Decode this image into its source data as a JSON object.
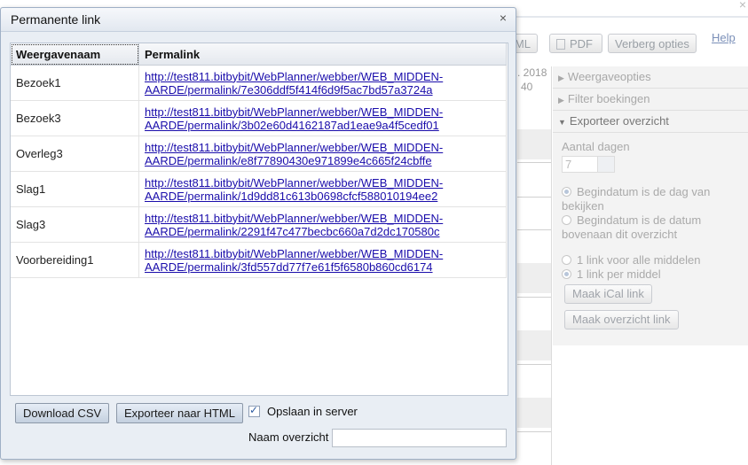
{
  "background": {
    "toolbar": {
      "html_label": "ML",
      "pdf_label": "PDF",
      "hide_label": "Verberg opties",
      "help_label": "Help"
    },
    "date_line1": ". 2018",
    "date_line2": "40",
    "sidebar": {
      "section_view": "Weergaveopties",
      "section_filter": "Filter boekingen",
      "section_export": "Exporteer overzicht",
      "days_label": "Aantal dagen",
      "days_value": "7",
      "radio_start_view": "Begindatum is de dag van bekijken",
      "radio_start_top": "Begindatum is de datum bovenaan dit overzicht",
      "radio_one_link": "1 link voor alle middelen",
      "radio_per_link": "1 link per middel",
      "ical_button": "Maak iCal link",
      "overview_button": "Maak overzicht link"
    }
  },
  "dialog": {
    "title": "Permanente link",
    "close": "×",
    "columns": {
      "name": "Weergavenaam",
      "link": "Permalink"
    },
    "rows": [
      {
        "name": "Bezoek1",
        "link_line1": "http://test811.bitbybit/WebPlanner/webber/WEB_MIDDEN-",
        "link_line2": "AARDE/permalink/7e306ddf5f414f6d9f5ac7bd57a3724a"
      },
      {
        "name": "Bezoek3",
        "link_line1": "http://test811.bitbybit/WebPlanner/webber/WEB_MIDDEN-",
        "link_line2": "AARDE/permalink/3b02e60d4162187ad1eae9a4f5cedf01"
      },
      {
        "name": "Overleg3",
        "link_line1": "http://test811.bitbybit/WebPlanner/webber/WEB_MIDDEN-",
        "link_line2": "AARDE/permalink/e8f77890430e971899e4c665f24cbffe"
      },
      {
        "name": "Slag1",
        "link_line1": "http://test811.bitbybit/WebPlanner/webber/WEB_MIDDEN-",
        "link_line2": "AARDE/permalink/1d9dd81c613b0698cfcf588010194ee2"
      },
      {
        "name": "Slag3",
        "link_line1": "http://test811.bitbybit/WebPlanner/webber/WEB_MIDDEN-",
        "link_line2": "AARDE/permalink/2291f47c477becbc660a7d2dc170580c"
      },
      {
        "name": "Voorbereiding1",
        "link_line1": "http://test811.bitbybit/WebPlanner/webber/WEB_MIDDEN-",
        "link_line2": "AARDE/permalink/3fd557dd77f7e61f5f6580b860cd6174"
      }
    ],
    "download_csv": "Download CSV",
    "export_html": "Exporteer naar HTML",
    "save_server_label": "Opslaan in server",
    "save_server_checked": true,
    "name_label": "Naam overzicht",
    "name_value": ""
  }
}
